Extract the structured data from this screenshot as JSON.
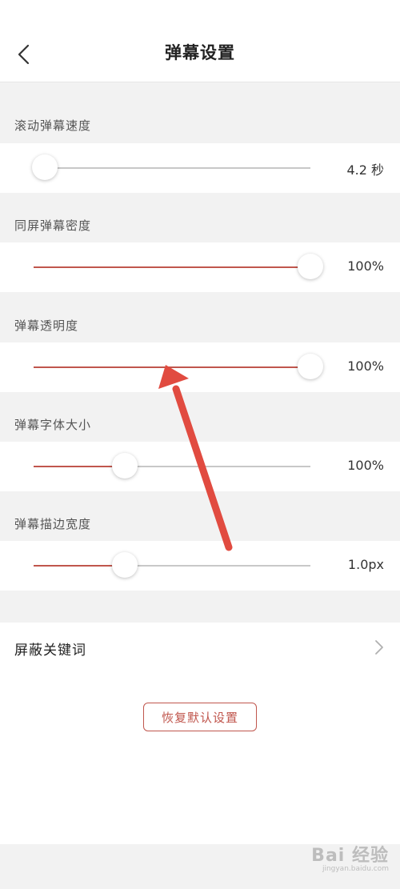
{
  "header": {
    "title": "弹幕设置",
    "back_icon": "chevron-left-icon"
  },
  "colors": {
    "accent": "#c0564d",
    "track_inactive": "#c8c8c8",
    "annotation_arrow": "#e14b40"
  },
  "settings": [
    {
      "label": "滚动弹幕速度",
      "value": "4.2 秒",
      "fill": 0.04
    },
    {
      "label": "同屏弹幕密度",
      "value": "100%",
      "fill": 1.0
    },
    {
      "label": "弹幕透明度",
      "value": "100%",
      "fill": 1.0
    },
    {
      "label": "弹幕字体大小",
      "value": "100%",
      "fill": 0.33
    },
    {
      "label": "弹幕描边宽度",
      "value": "1.0px",
      "fill": 0.33
    }
  ],
  "block_keywords": {
    "label": "屏蔽关键词",
    "icon": "chevron-right-icon"
  },
  "reset_button": {
    "label": "恢复默认设置"
  },
  "watermark": {
    "brand": "Bai 经验",
    "site": "jingyan.baidu.com"
  }
}
